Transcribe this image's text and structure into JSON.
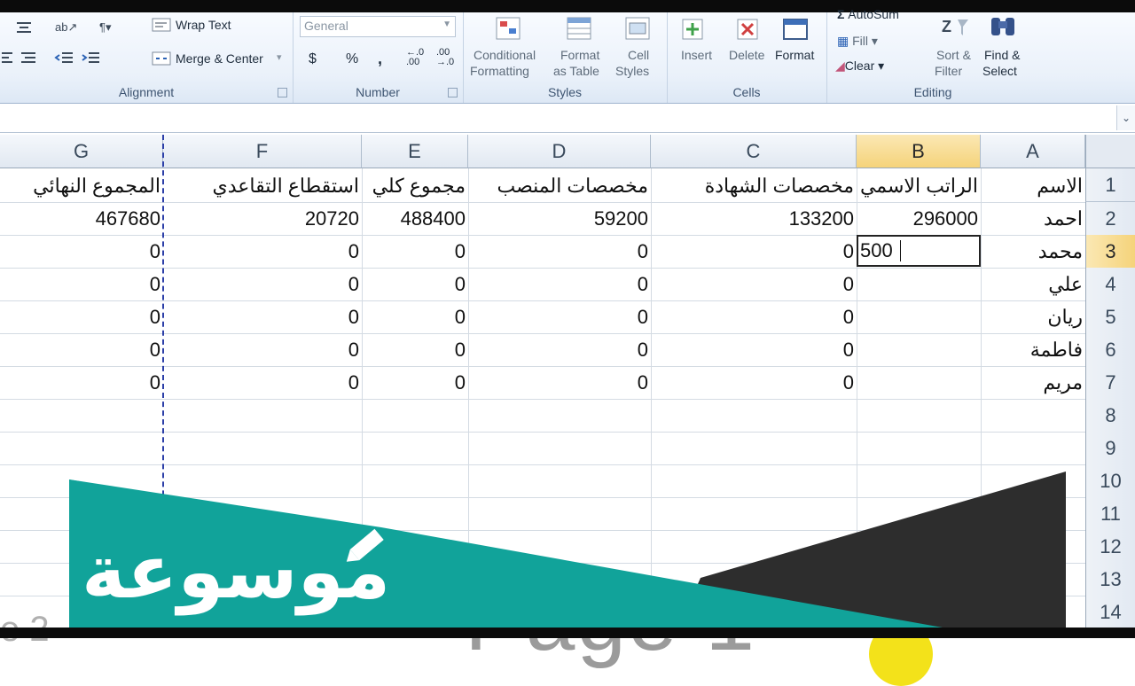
{
  "ribbon": {
    "alignment": {
      "wrap_text": "Wrap Text",
      "merge_center": "Merge & Center",
      "merge_arrow": "▾",
      "group_label": "Alignment"
    },
    "number": {
      "format_value": "General",
      "currency": "$",
      "percent": "%",
      "comma": ",",
      "inc_decimal": "←.0 .00",
      "dec_decimal": ".00 →.0",
      "group_label": "Number"
    },
    "styles": {
      "conditional_line1": "Conditional",
      "conditional_line2": "Formatting",
      "format_table_line1": "Format",
      "format_table_line2": "as Table",
      "cell_styles_line1": "Cell",
      "cell_styles_line2": "Styles",
      "group_label": "Styles"
    },
    "cells": {
      "insert": "Insert",
      "delete": "Delete",
      "format": "Format",
      "group_label": "Cells"
    },
    "editing": {
      "autosum": "AutoSum",
      "fill": "Fill",
      "clear": "Clear",
      "sort_line1": "Sort &",
      "sort_line2": "Filter",
      "find_line1": "Find &",
      "find_line2": "Select",
      "group_label": "Editing"
    }
  },
  "sheet": {
    "columns": [
      "G",
      "F",
      "E",
      "D",
      "C",
      "B",
      "A"
    ],
    "selected_column": "B",
    "rows": [
      "1",
      "2",
      "3",
      "4",
      "5",
      "6",
      "7",
      "8",
      "9",
      "10",
      "11",
      "12",
      "13",
      "14"
    ],
    "selected_row": "3",
    "header_row": {
      "A": "الاسم",
      "B": "الراتب الاسمي",
      "C": "مخصصات الشهادة",
      "D": "مخصصات المنصب",
      "E": "مجموع كلي",
      "F": "استقطاع التقاعدي",
      "G": "المجموع النهائي"
    },
    "data_rows": [
      {
        "A": "احمد",
        "B": "296000",
        "C": "133200",
        "D": "59200",
        "E": "488400",
        "F": "20720",
        "G": "467680"
      },
      {
        "A": "محمد",
        "B": "",
        "C": "0",
        "D": "0",
        "E": "0",
        "F": "0",
        "G": "0"
      },
      {
        "A": "علي",
        "B": "",
        "C": "0",
        "D": "0",
        "E": "0",
        "F": "0",
        "G": "0"
      },
      {
        "A": "ريان",
        "B": "",
        "C": "0",
        "D": "0",
        "E": "0",
        "F": "0",
        "G": "0"
      },
      {
        "A": "فاطمة",
        "B": "",
        "C": "0",
        "D": "0",
        "E": "0",
        "F": "0",
        "G": "0"
      },
      {
        "A": "مريم",
        "B": "",
        "C": "0",
        "D": "0",
        "E": "0",
        "F": "0",
        "G": "0"
      }
    ],
    "active_cell_value": "500",
    "page_watermark_1": "Page 1",
    "page_watermark_2": "e 2"
  },
  "banner": {
    "logo_text": "موسوعة",
    "colors": {
      "teal": "#11a39a",
      "dark": "#2d2d2d"
    }
  }
}
